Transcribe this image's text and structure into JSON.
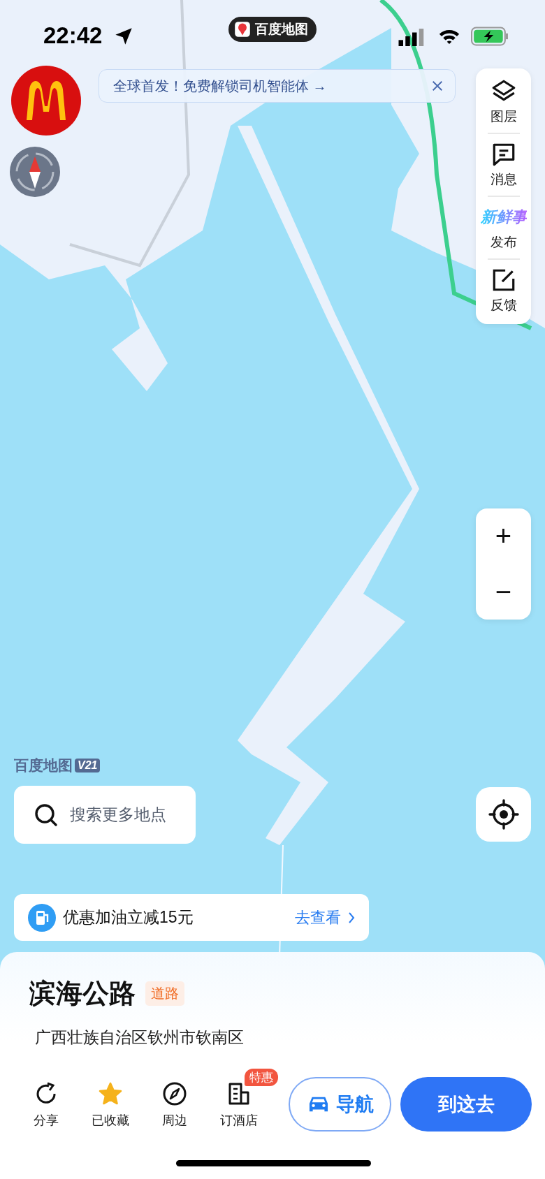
{
  "status_bar": {
    "time": "22:42",
    "app_pill": "百度地图"
  },
  "banner": {
    "text": "全球首发！免费解锁司机智能体 →"
  },
  "side_tools": [
    {
      "label": "图层",
      "kind": "layers"
    },
    {
      "label": "消息",
      "kind": "message"
    },
    {
      "label": "发布",
      "kind": "publish",
      "badge": "新鲜事"
    },
    {
      "label": "反馈",
      "kind": "feedback"
    }
  ],
  "zoom": {
    "in": "+",
    "out": "−"
  },
  "map_logo": {
    "name": "百度地图",
    "version": "V21"
  },
  "search": {
    "placeholder": "搜索更多地点"
  },
  "promo": {
    "text": "优惠加油立减15元",
    "link": "去查看"
  },
  "place": {
    "title": "滨海公路",
    "tag": "道路",
    "address": "广西壮族自治区钦州市钦南区"
  },
  "actions": [
    {
      "label": "分享",
      "kind": "share",
      "on": false
    },
    {
      "label": "已收藏",
      "kind": "favorite",
      "on": true
    },
    {
      "label": "周边",
      "kind": "nearby",
      "on": false
    },
    {
      "label": "订酒店",
      "kind": "hotel",
      "on": false,
      "badge": "特惠"
    }
  ],
  "buttons": {
    "navigate": "导航",
    "go": "到这去"
  }
}
